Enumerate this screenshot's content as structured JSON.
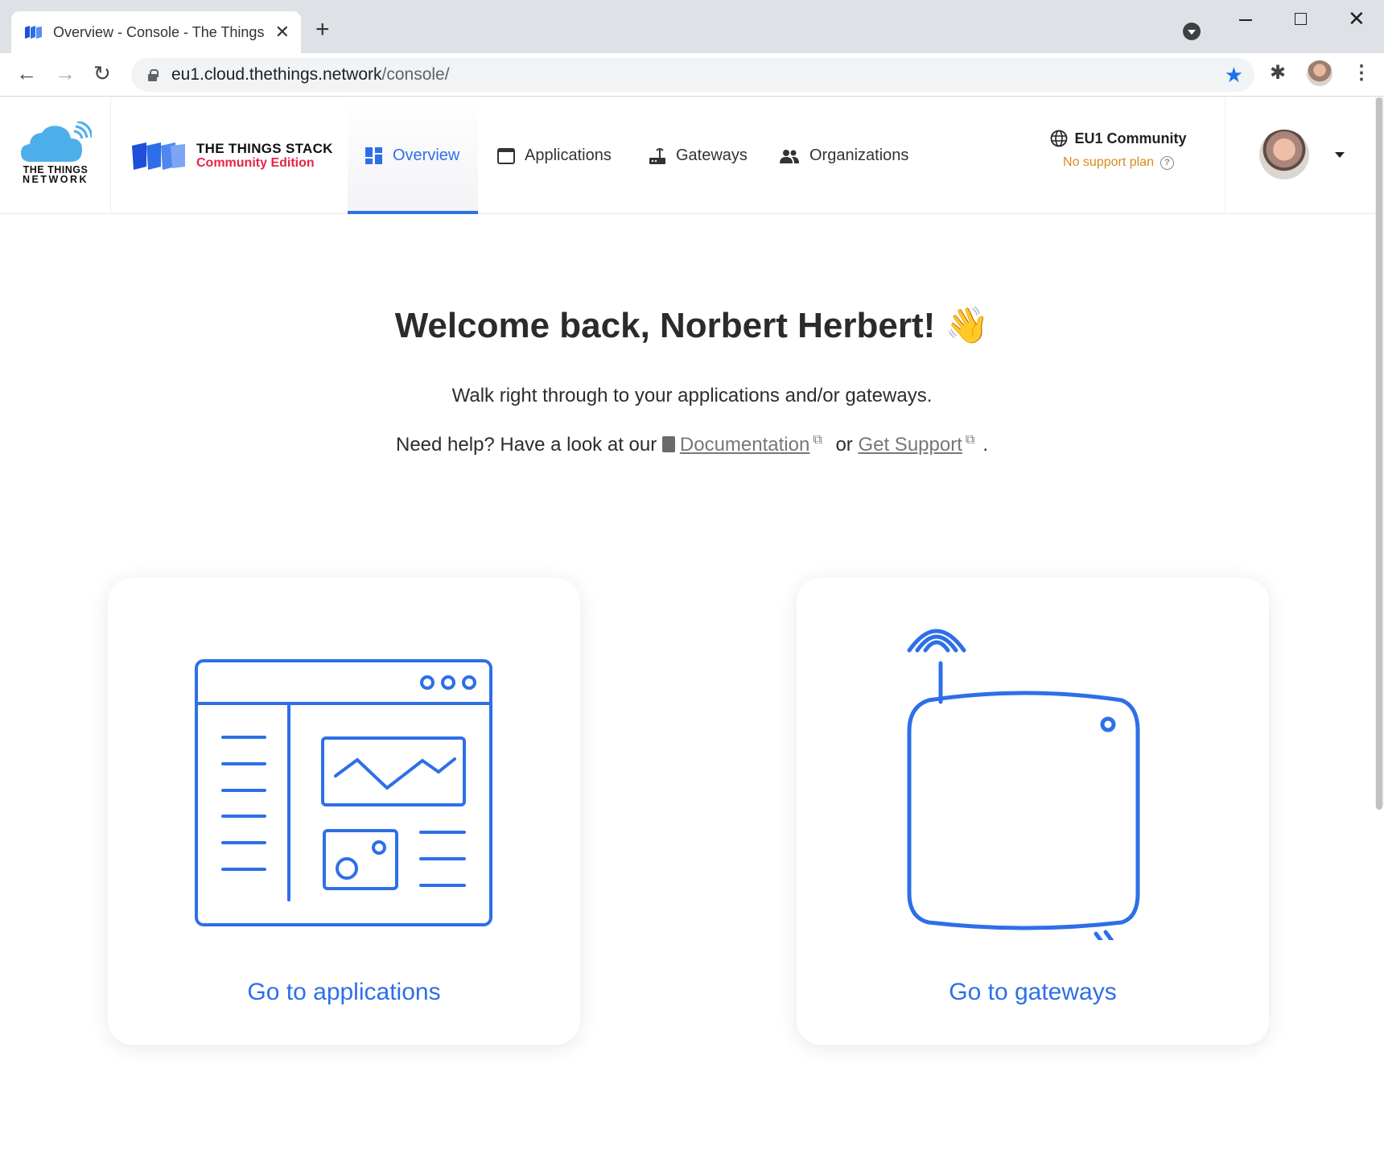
{
  "browser": {
    "tab_title": "Overview - Console - The Things Stack",
    "tab_close": "✕",
    "new_tab": "+",
    "url_host": "eu1.cloud.thethings.network",
    "url_path": "/console/"
  },
  "brand": {
    "ttn_line1": "THE THINGS",
    "ttn_line2": "NETWORK",
    "tts_line1": "THE THINGS STACK",
    "tts_line2": "Community Edition",
    "accent": "#2e6fe8",
    "edition_color": "#e5254a"
  },
  "nav": {
    "items": [
      {
        "label": "Overview",
        "icon": "dashboard-icon",
        "active": true
      },
      {
        "label": "Applications",
        "icon": "application-window-icon",
        "active": false
      },
      {
        "label": "Gateways",
        "icon": "router-icon",
        "active": false
      },
      {
        "label": "Organizations",
        "icon": "people-icon",
        "active": false
      }
    ]
  },
  "cluster": {
    "name": "EU1 Community",
    "plan": "No support plan",
    "help": "?"
  },
  "main": {
    "welcome": "Welcome back, Norbert Herbert! 👋",
    "subtitle": "Walk right through to your applications and/or gateways.",
    "help_prefix": "Need help? Have a look at our",
    "doc_link": "Documentation",
    "or_text": "or",
    "support_link": "Get Support",
    "period": ".",
    "ext_mark": "⧉"
  },
  "cards": {
    "applications": {
      "label": "Go to applications"
    },
    "gateways": {
      "label": "Go to gateways"
    }
  }
}
